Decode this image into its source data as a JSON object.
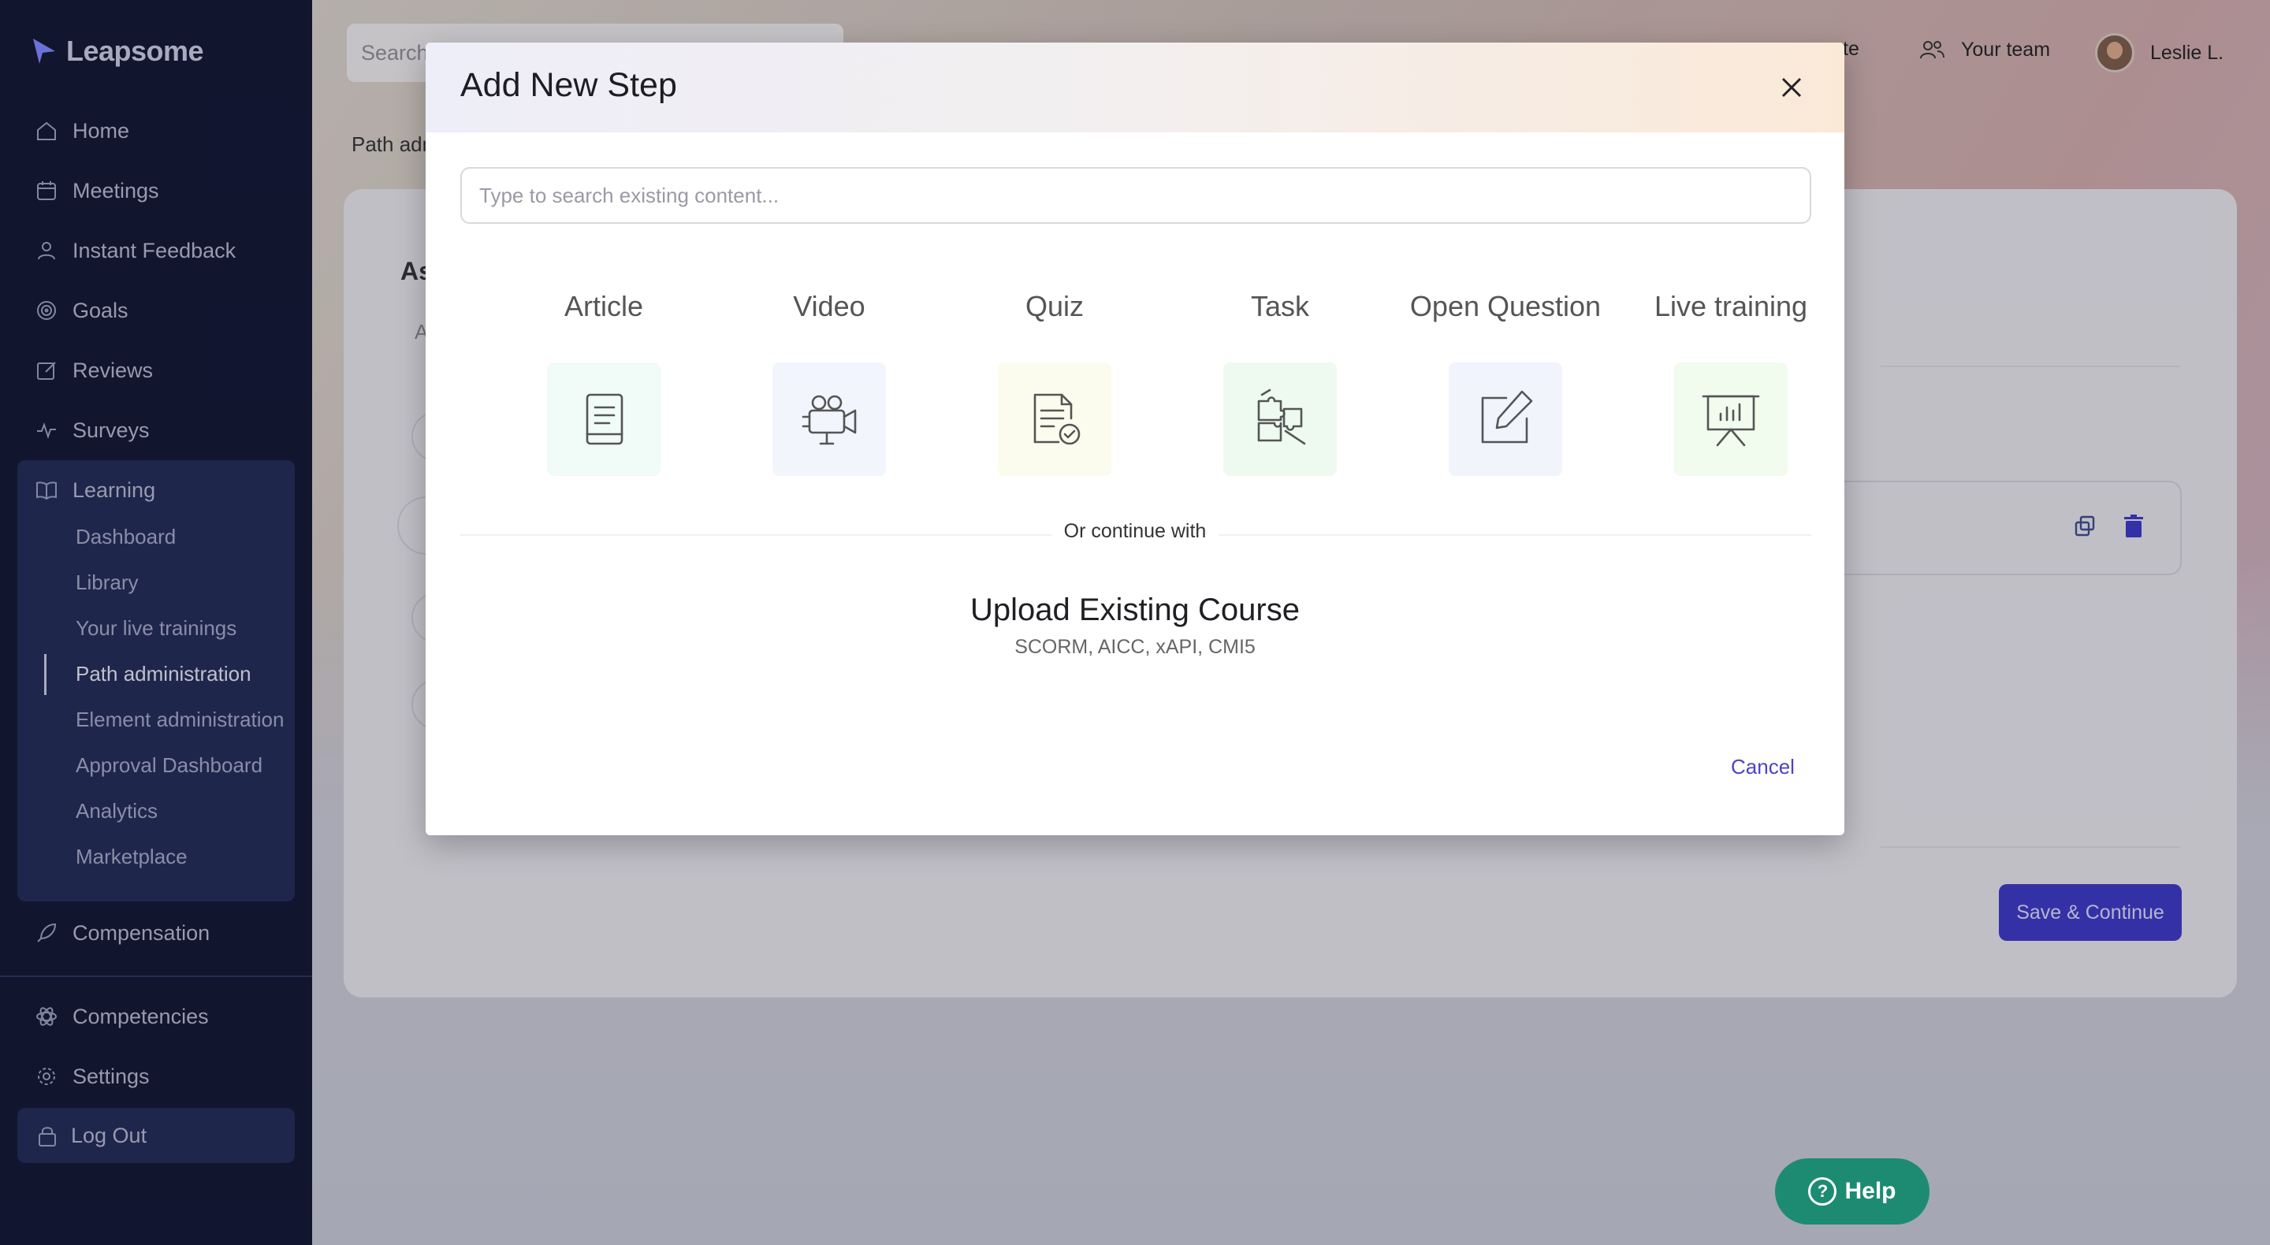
{
  "app": {
    "brand": "Leapsome",
    "accent_color": "#3b37c4"
  },
  "sidebar": {
    "items": [
      {
        "label": "Home",
        "icon": "home-icon"
      },
      {
        "label": "Meetings",
        "icon": "calendar-icon"
      },
      {
        "label": "Instant Feedback",
        "icon": "feedback-icon"
      },
      {
        "label": "Goals",
        "icon": "target-icon"
      },
      {
        "label": "Reviews",
        "icon": "edit-icon"
      },
      {
        "label": "Surveys",
        "icon": "pulse-icon"
      },
      {
        "label": "Learning",
        "icon": "book-icon"
      }
    ],
    "learning_subitems": [
      {
        "label": "Dashboard"
      },
      {
        "label": "Library"
      },
      {
        "label": "Your live trainings"
      },
      {
        "label": "Path administration",
        "active": true
      },
      {
        "label": "Element administration"
      },
      {
        "label": "Approval Dashboard"
      },
      {
        "label": "Analytics"
      },
      {
        "label": "Marketplace"
      }
    ],
    "compensation": "Compensation",
    "competencies": "Competencies",
    "settings": "Settings",
    "logout": "Log Out"
  },
  "header": {
    "search_placeholder": "Search",
    "link_partial": "te",
    "your_team": "Your team",
    "user_name": "Leslie L."
  },
  "page": {
    "breadcrumb": "Path adm",
    "card_title_partial": "As",
    "card_sub_partial": "A",
    "save_continue": "Save & Continue",
    "help": "Help"
  },
  "modal": {
    "title": "Add New Step",
    "search_placeholder": "Type to search existing content...",
    "options": [
      {
        "label": "Article",
        "icon": "book-icon",
        "tile_color": "#f1fbf7"
      },
      {
        "label": "Video",
        "icon": "camera-icon",
        "tile_color": "#f3f5fd"
      },
      {
        "label": "Quiz",
        "icon": "quiz-icon",
        "tile_color": "#fbfcee"
      },
      {
        "label": "Task",
        "icon": "puzzle-icon",
        "tile_color": "#eefaf0"
      },
      {
        "label": "Open Question",
        "icon": "pencil-square-icon",
        "tile_color": "#f2f4fc"
      },
      {
        "label": "Live training",
        "icon": "presentation-icon",
        "tile_color": "#f1fbee"
      }
    ],
    "or_continue": "Or continue with",
    "upload_title": "Upload Existing Course",
    "upload_formats": "SCORM, AICC, xAPI, CMI5",
    "cancel": "Cancel"
  }
}
